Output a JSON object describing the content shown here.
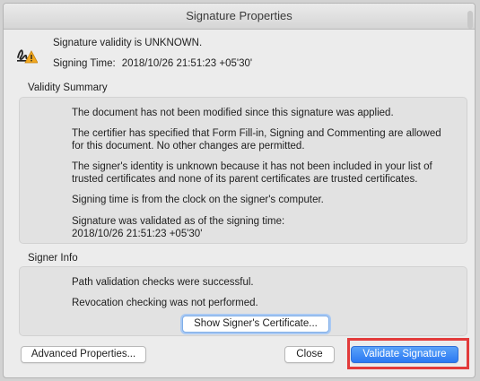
{
  "window": {
    "title": "Signature Properties"
  },
  "status": {
    "icon": "signature-warning-icon",
    "validity_text": "Signature validity is UNKNOWN.",
    "signing_time_label": "Signing Time:",
    "signing_time_value": "2018/10/26 21:51:23 +05'30'"
  },
  "validity_summary": {
    "label": "Validity Summary",
    "lines": [
      "The document has not been modified since this signature was applied.",
      "The certifier has specified that Form Fill-in, Signing and Commenting are allowed for this document. No other changes are permitted.",
      "The signer's identity is unknown because it has not been included in your list of trusted certificates and none of its parent certificates are trusted certificates.",
      "Signing time is from the clock on the signer's computer.",
      "Signature was validated as of the signing time:",
      "2018/10/26 21:51:23 +05'30'"
    ]
  },
  "signer_info": {
    "label": "Signer Info",
    "lines": [
      "Path validation checks were successful.",
      "Revocation checking was not performed."
    ],
    "show_certificate_button": "Show Signer's Certificate..."
  },
  "buttons": {
    "advanced": "Advanced Properties...",
    "close": "Close",
    "validate": "Validate Signature"
  },
  "colors": {
    "primary_button": "#2b79f3",
    "highlight_border": "#e23b3b",
    "warning_icon": "#f2a91f"
  }
}
